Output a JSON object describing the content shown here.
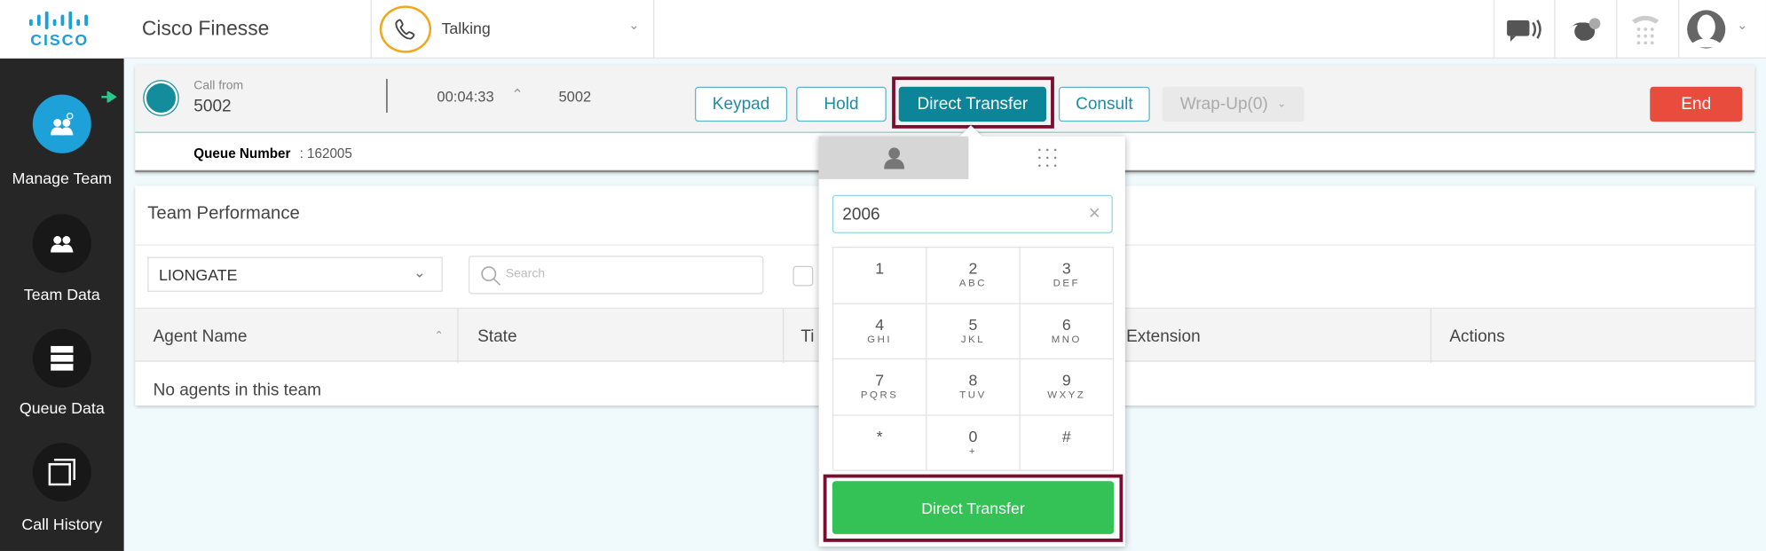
{
  "header": {
    "brand": "CISCO",
    "title": "Cisco Finesse",
    "status": "Talking"
  },
  "sidebar": {
    "items": [
      {
        "label": "Manage Team"
      },
      {
        "label": "Team Data"
      },
      {
        "label": "Queue Data"
      },
      {
        "label": "Call History"
      }
    ]
  },
  "call": {
    "call_from_label": "Call from",
    "caller": "5002",
    "duration": "00:04:33",
    "extension": "5002",
    "queue_label": "Queue Number",
    "queue_sep": " : ",
    "queue_value": "162005",
    "buttons": {
      "keypad": "Keypad",
      "hold": "Hold",
      "direct_transfer": "Direct Transfer",
      "consult": "Consult",
      "wrapup": "Wrap-Up(0)",
      "end": "End"
    }
  },
  "team": {
    "title": "Team Performance",
    "team_select": "LIONGATE",
    "search_placeholder": "Search",
    "columns": [
      "Agent Name",
      "State",
      "Ti",
      "Extension",
      "Actions"
    ],
    "empty": "No agents in this team"
  },
  "dialpad": {
    "input_value": "2006",
    "keys": [
      [
        "1",
        ""
      ],
      [
        "2",
        "ABC"
      ],
      [
        "3",
        "DEF"
      ],
      [
        "4",
        "GHI"
      ],
      [
        "5",
        "JKL"
      ],
      [
        "6",
        "MNO"
      ],
      [
        "7",
        "PQRS"
      ],
      [
        "8",
        "TUV"
      ],
      [
        "9",
        "WXYZ"
      ],
      [
        "*",
        ""
      ],
      [
        "0",
        "+"
      ],
      [
        "#",
        ""
      ]
    ],
    "submit": "Direct Transfer"
  },
  "colors": {
    "accent": "#1e8ca6",
    "primary_button": "#0d8599",
    "end": "#e74c3c",
    "submit": "#34c155",
    "highlight": "#7b0d2e",
    "status_ring": "#f0a81c"
  }
}
